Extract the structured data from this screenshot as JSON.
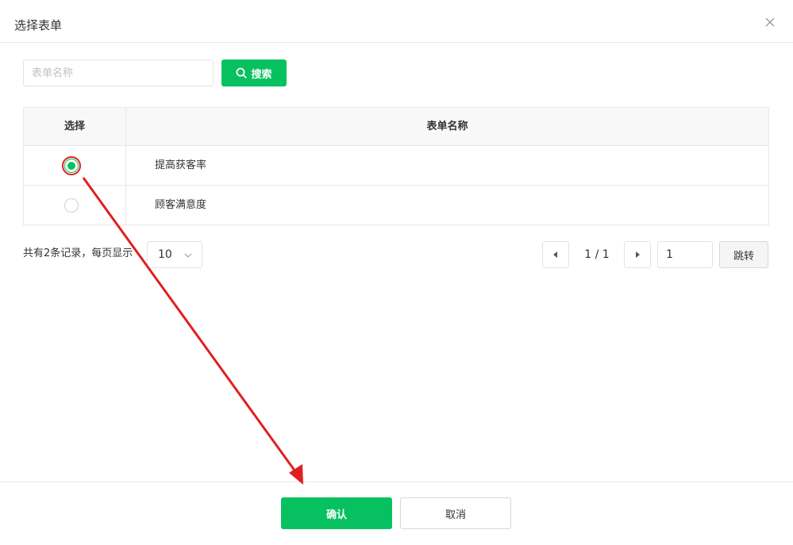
{
  "dialog": {
    "title": "选择表单",
    "close_icon": "close-icon"
  },
  "search": {
    "placeholder": "表单名称",
    "value": "",
    "button_label": "搜索",
    "button_icon": "search-icon"
  },
  "table": {
    "columns": [
      "选择",
      "表单名称"
    ],
    "rows": [
      {
        "name": "提高获客率",
        "selected": true
      },
      {
        "name": "顾客满意度",
        "selected": false
      }
    ]
  },
  "pagination": {
    "record_text": "共有2条记录，每页显示",
    "page_size": "10",
    "page_info": "1 / 1",
    "jump_value": "1",
    "jump_label": "跳转"
  },
  "footer": {
    "confirm_label": "确认",
    "cancel_label": "取消"
  },
  "colors": {
    "primary": "#07c160",
    "annotation": "#e02020"
  }
}
